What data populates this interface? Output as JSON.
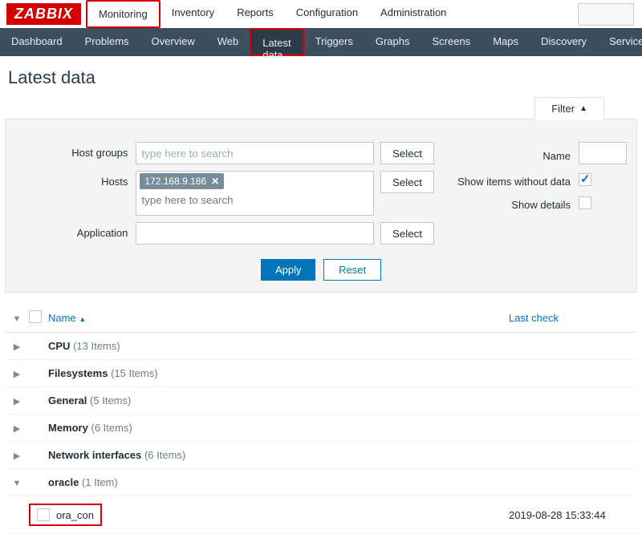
{
  "logo": "ZABBIX",
  "top_tabs": [
    "Monitoring",
    "Inventory",
    "Reports",
    "Configuration",
    "Administration"
  ],
  "top_active": "Monitoring",
  "sub_nav": [
    "Dashboard",
    "Problems",
    "Overview",
    "Web",
    "Latest data",
    "Triggers",
    "Graphs",
    "Screens",
    "Maps",
    "Discovery",
    "Services"
  ],
  "sub_active": "Latest data",
  "page_title": "Latest data",
  "filter": {
    "toggle_label": "Filter",
    "host_groups_label": "Host groups",
    "host_groups_placeholder": "type here to search",
    "hosts_label": "Hosts",
    "hosts_tag": "172.168.9.186",
    "hosts_placeholder": "type here to search",
    "application_label": "Application",
    "select_label": "Select",
    "name_label": "Name",
    "show_without_label": "Show items without data",
    "show_without_checked": true,
    "show_details_label": "Show details",
    "apply_label": "Apply",
    "reset_label": "Reset"
  },
  "table": {
    "name_header": "Name",
    "lastcheck_header": "Last check",
    "groups": [
      {
        "name": "CPU",
        "count": "(13 Items)",
        "expanded": false
      },
      {
        "name": "Filesystems",
        "count": "(15 Items)",
        "expanded": false
      },
      {
        "name": "General",
        "count": "(5 Items)",
        "expanded": false
      },
      {
        "name": "Memory",
        "count": "(6 Items)",
        "expanded": false
      },
      {
        "name": "Network interfaces",
        "count": "(6 Items)",
        "expanded": false
      },
      {
        "name": "oracle",
        "count": "(1 Item)",
        "expanded": true
      }
    ],
    "item": {
      "name": "ora_con",
      "last_check": "2019-08-28 15:33:44"
    }
  }
}
